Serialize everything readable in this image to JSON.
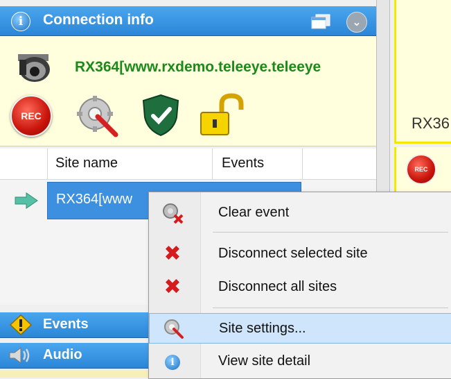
{
  "connection_panel": {
    "title": "Connection info",
    "info_icon": "i",
    "site_title": "RX364[www.rxdemo.teleeye.teleeye",
    "rec_label": "REC"
  },
  "site_table": {
    "columns": [
      "Site name",
      "Events"
    ],
    "rows": [
      {
        "site_name": "RX364[www"
      }
    ]
  },
  "sections": {
    "events_label": "Events",
    "audio_label": "Audio"
  },
  "right_panel": {
    "preview_label": "RX36",
    "rec_small_label": "REC"
  },
  "context_menu": {
    "items": [
      {
        "label": "Clear event",
        "icon": "clear-event-icon"
      },
      {
        "label": "Disconnect selected site",
        "icon": "x-icon"
      },
      {
        "label": "Disconnect all sites",
        "icon": "x-icon"
      },
      {
        "label": "Site settings...",
        "icon": "settings-icon",
        "hovered": true
      },
      {
        "label": "View site detail",
        "icon": "info-icon"
      }
    ]
  },
  "colors": {
    "header_blue": "#2b86d8",
    "site_title_green": "#1b8a1b",
    "selection_blue": "#3d8fe0",
    "menu_hover": "#cfe5fb",
    "card_yellow": "#fffedd"
  }
}
